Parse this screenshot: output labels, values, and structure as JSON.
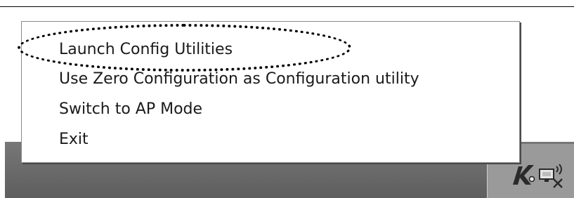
{
  "menu": {
    "items": [
      {
        "label": "Launch Config Utilities"
      },
      {
        "label": "Use Zero Configuration as Configuration utility"
      },
      {
        "label": "Switch to AP Mode"
      },
      {
        "label": "Exit"
      }
    ]
  },
  "tray": {
    "icons": [
      "wireless-utility-icon",
      "network-connection-disconnected-icon"
    ]
  },
  "colors": {
    "taskbar": "#6a6a6a",
    "tray": "#9a9a9a",
    "menu_background": "#ffffff",
    "annotation": "#000000"
  }
}
